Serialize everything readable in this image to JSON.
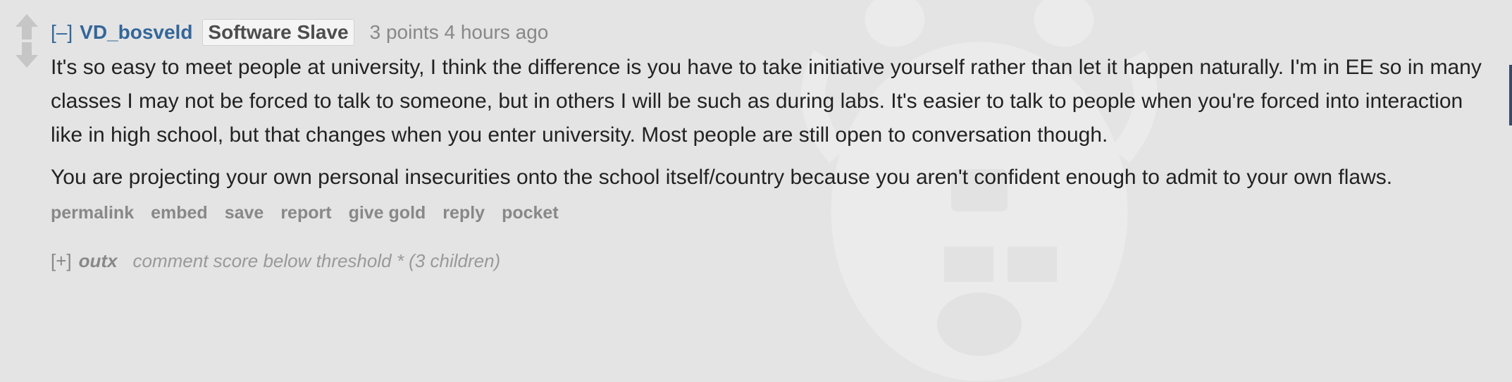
{
  "comment": {
    "collapse_toggle": "[–]",
    "author": "VD_bosveld",
    "flair": "Software Slave",
    "score_text": "3 points 4 hours ago",
    "paragraphs": [
      "It's so easy to meet people at university, I think the difference is you have to take initiative yourself rather than let it happen naturally. I'm in EE so in many classes I may not be forced to talk to someone, but in others I will be such as during labs. It's easier to talk to people when you're forced into interaction like in high school, but that changes when you enter university. Most people are still open to conversation though.",
      "You are projecting your own personal insecurities onto the school itself/country because you aren't confident enough to admit to your own flaws."
    ],
    "buttons": [
      "permalink",
      "embed",
      "save",
      "report",
      "give gold",
      "reply",
      "pocket"
    ]
  },
  "collapsed_child": {
    "expand_toggle": "[+]",
    "author": "outx",
    "note": "comment score below threshold * (3 children)"
  },
  "icons": {
    "upvote": "arrow-up-icon",
    "downvote": "arrow-down-icon",
    "watermark": "reddit-alien-watermark-icon"
  },
  "colors": {
    "background": "#e4e4e4",
    "author": "#336699",
    "button_text": "#888888",
    "vote_arrow": "#c6c6c6"
  }
}
